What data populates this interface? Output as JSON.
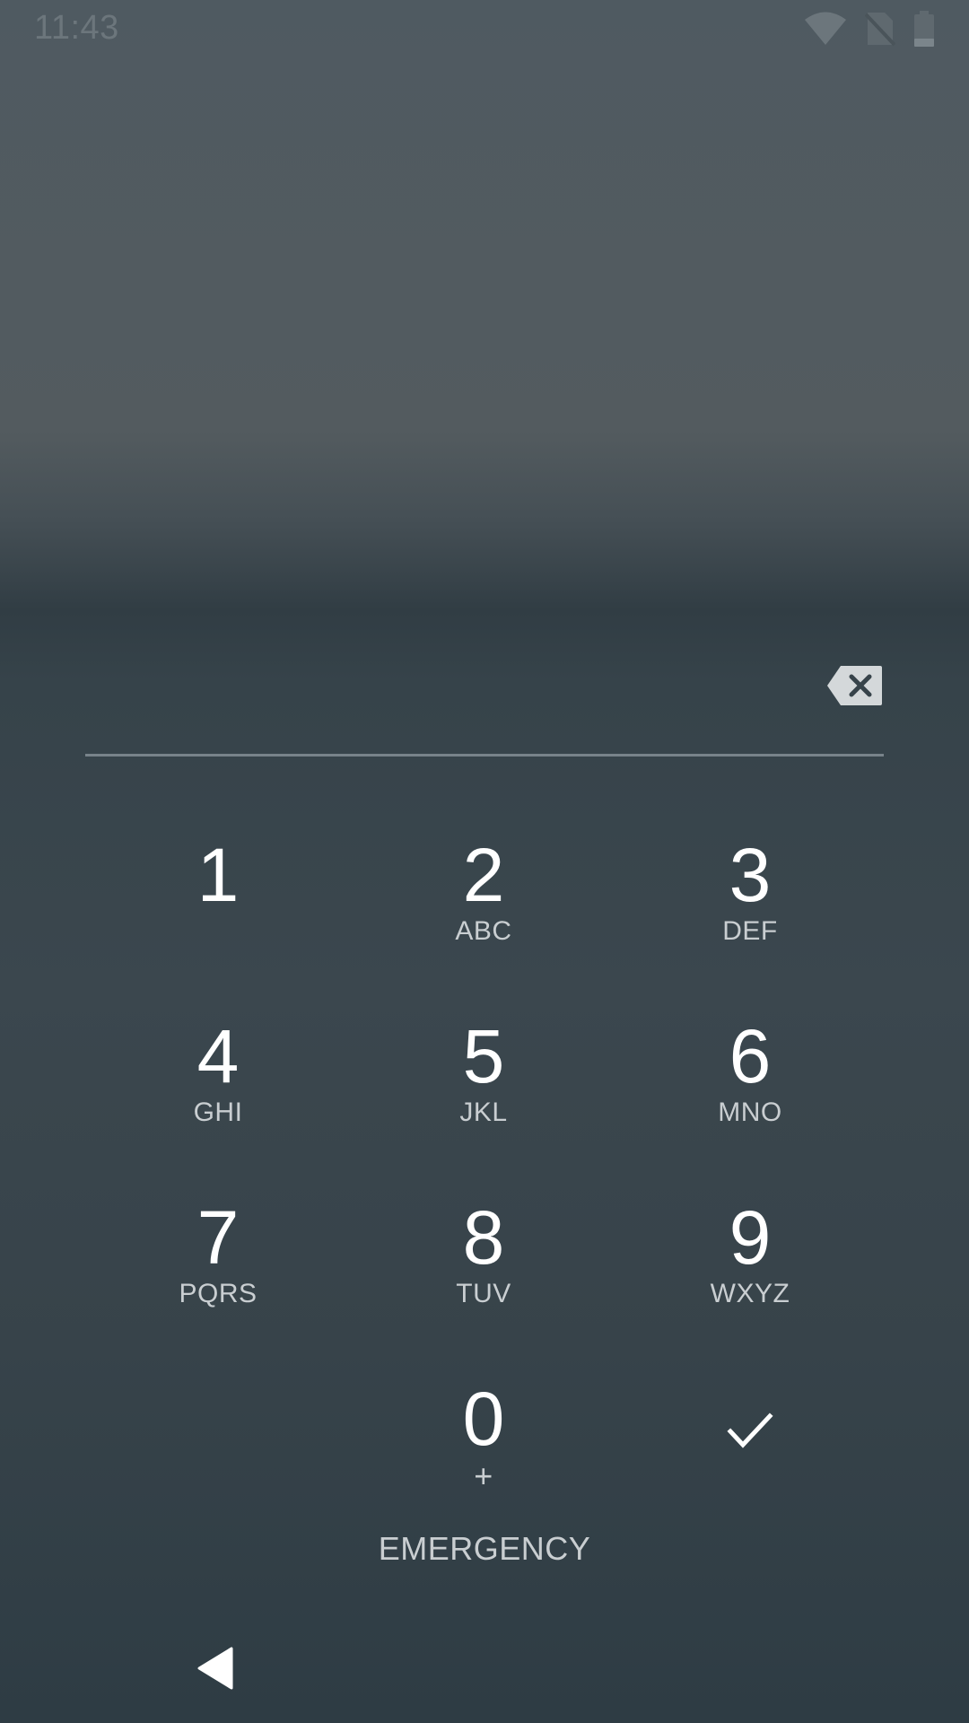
{
  "status_bar": {
    "time": "11:43",
    "icons": [
      "wifi-icon",
      "no-sim-icon",
      "battery-icon"
    ]
  },
  "pin_entry": {
    "value": "",
    "backspace_icon": "backspace-icon"
  },
  "keypad": {
    "keys": [
      {
        "digit": "1",
        "letters": ""
      },
      {
        "digit": "2",
        "letters": "ABC"
      },
      {
        "digit": "3",
        "letters": "DEF"
      },
      {
        "digit": "4",
        "letters": "GHI"
      },
      {
        "digit": "5",
        "letters": "JKL"
      },
      {
        "digit": "6",
        "letters": "MNO"
      },
      {
        "digit": "7",
        "letters": "PQRS"
      },
      {
        "digit": "8",
        "letters": "TUV"
      },
      {
        "digit": "9",
        "letters": "WXYZ"
      },
      {
        "digit": "0",
        "letters": "+"
      }
    ],
    "confirm_icon": "checkmark-icon"
  },
  "emergency": {
    "label": "EMERGENCY"
  },
  "nav_bar": {
    "back_icon": "back-triangle-icon"
  },
  "colors": {
    "text_primary": "#ffffff",
    "text_secondary": "#c9ced1",
    "status_text": "#6c767c",
    "underline": "#78838a"
  }
}
